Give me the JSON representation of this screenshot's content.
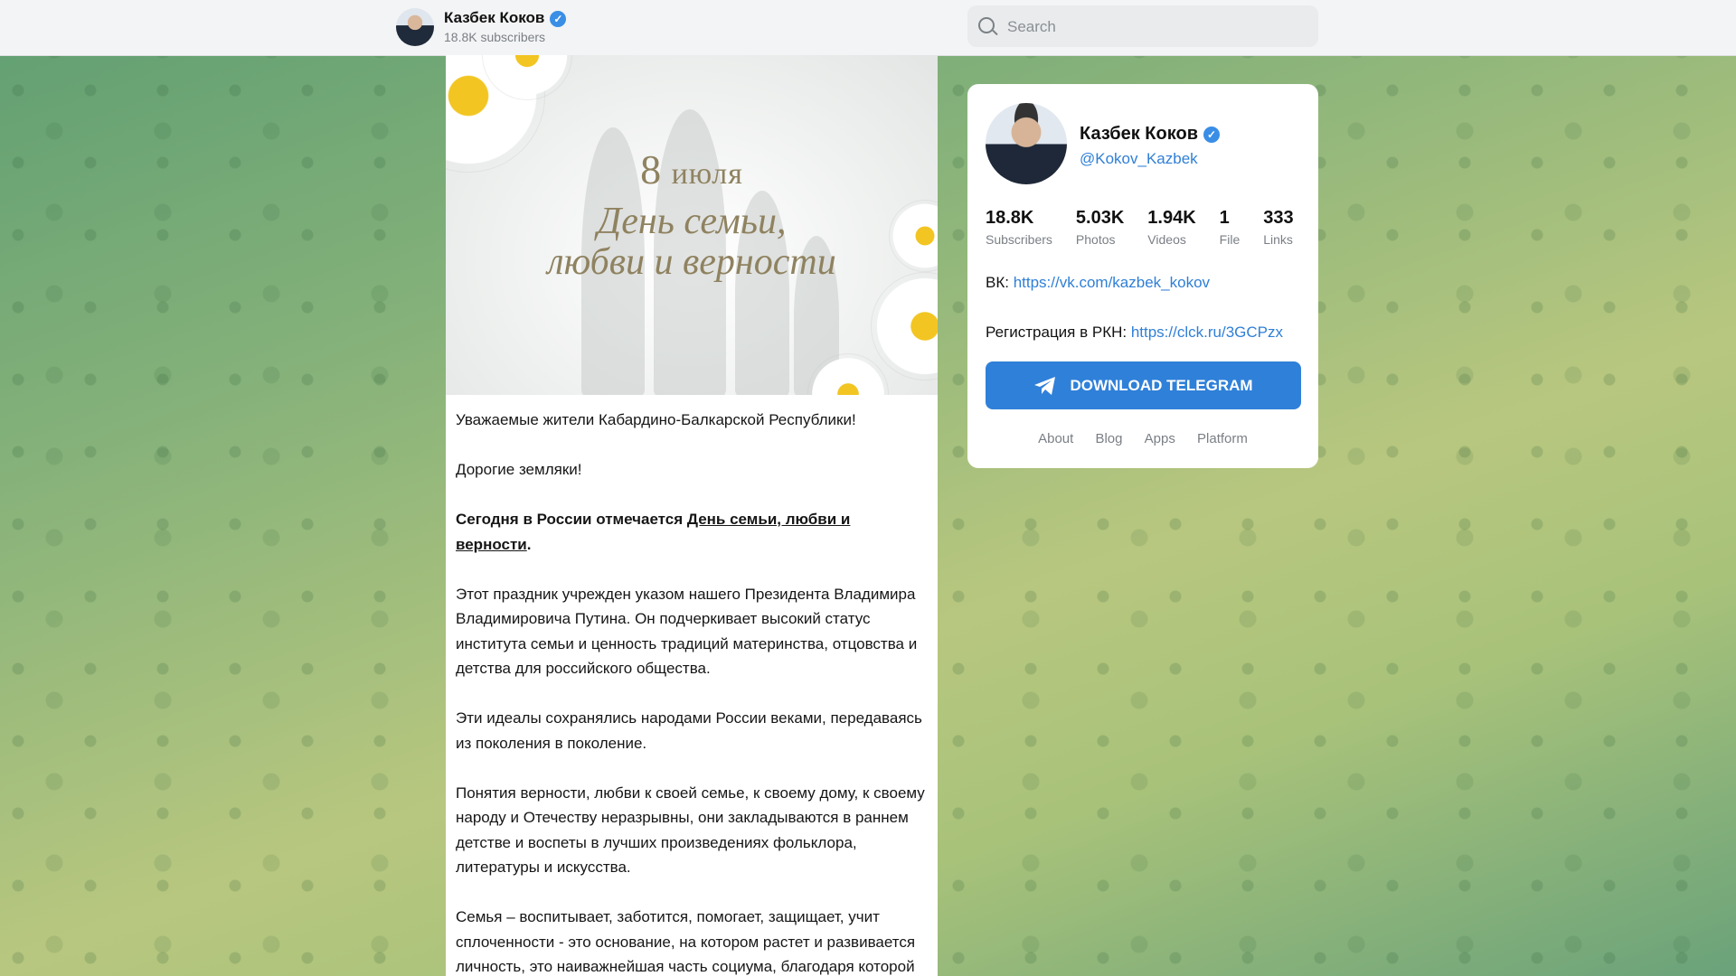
{
  "header": {
    "channel_name": "Казбек Коков",
    "subscribers": "18.8K subscribers",
    "search_placeholder": "Search"
  },
  "post": {
    "image": {
      "date_number": "8",
      "date_month": "июля",
      "line1": "День семьи,",
      "line2": "любви и верности"
    },
    "paragraphs": [
      "Уважаемые жители Кабардино-Балкарской Республики!",
      "Дорогие земляки!",
      "Этот праздник учрежден указом нашего Президента Владимира Владимировича Путина. Он подчеркивает высокий статус института семьи и ценность традиций материнства, отцовства и детства для российского общества.",
      "Эти идеалы сохранялись народами России веками, передаваясь из поколения в поколение.",
      "Понятия верности, любви к своей семье, к своему дому, к своему народу и Отечеству неразрывны, они закладываются в раннем детстве и воспеты в лучших произведениях фольклора, литературы и искусства.",
      "Семья – воспитывает, заботится, помогает, защищает, учит сплоченности - это основание, на котором растет и развивается личность, это наиважнейшая часть социума, благодаря которой стал возможным прогресс человечества."
    ],
    "bold_prefix": "Сегодня в России отмечается ",
    "bold_link": "День семьи, любви и верности",
    "bold_suffix": "."
  },
  "card": {
    "name": "Казбек Коков",
    "handle": "@Kokov_Kazbek",
    "stats": [
      {
        "value": "18.8K",
        "label": "Subscribers"
      },
      {
        "value": "5.03K",
        "label": "Photos"
      },
      {
        "value": "1.94K",
        "label": "Videos"
      },
      {
        "value": "1",
        "label": "File"
      },
      {
        "value": "333",
        "label": "Links"
      }
    ],
    "vk_label": "ВК: ",
    "vk_link": "https://vk.com/kazbek_kokov",
    "rkn_label": "Регистрация в РКН: ",
    "rkn_link": "https://clck.ru/3GCPzx",
    "download_label": "DOWNLOAD TELEGRAM",
    "footer_links": [
      "About",
      "Blog",
      "Apps",
      "Platform"
    ]
  },
  "colors": {
    "accent": "#2f80d9",
    "verified": "#3a8ee6"
  }
}
